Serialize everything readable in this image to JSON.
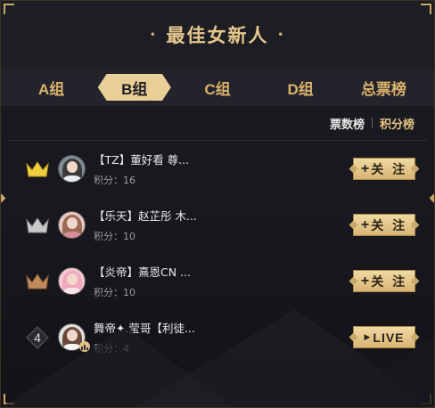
{
  "header": {
    "title": "最佳女新人",
    "title_dot": "•"
  },
  "tabs": [
    {
      "label": "A组",
      "active": false
    },
    {
      "label": "B组",
      "active": true
    },
    {
      "label": "C组",
      "active": false
    },
    {
      "label": "D组",
      "active": false
    },
    {
      "label": "总票榜",
      "active": false
    }
  ],
  "sort": {
    "votes_label": "票数榜",
    "points_label": "积分榜",
    "active": "积分榜"
  },
  "rows": [
    {
      "rank": 1,
      "rank_icon": "gold-crown-icon",
      "name": "【TZ】董好看 尊...",
      "score": "积分：16",
      "button": "关 注",
      "button_icon": "plus-icon"
    },
    {
      "rank": 2,
      "rank_icon": "silver-crown-icon",
      "name": "【乐天】赵芷彤 木...",
      "score": "积分：10",
      "button": "关 注",
      "button_icon": "plus-icon"
    },
    {
      "rank": 3,
      "rank_icon": "bronze-crown-icon",
      "name": "【炎帝】熹恩CN ...",
      "score": "积分：10",
      "button": "关 注",
      "button_icon": "plus-icon"
    },
    {
      "rank": 4,
      "rank_label": "4",
      "name": "舞帝✦.莹哥【利徒...",
      "score": "积分：4",
      "button": "LIVE",
      "button_icon": "play-icon"
    }
  ],
  "colors": {
    "gold": "#e6c78d",
    "active_tab": "#e9cf97",
    "crown_gold": "#f0d040",
    "crown_silver": "#c9c9c9",
    "crown_bronze": "#c08a5a"
  }
}
